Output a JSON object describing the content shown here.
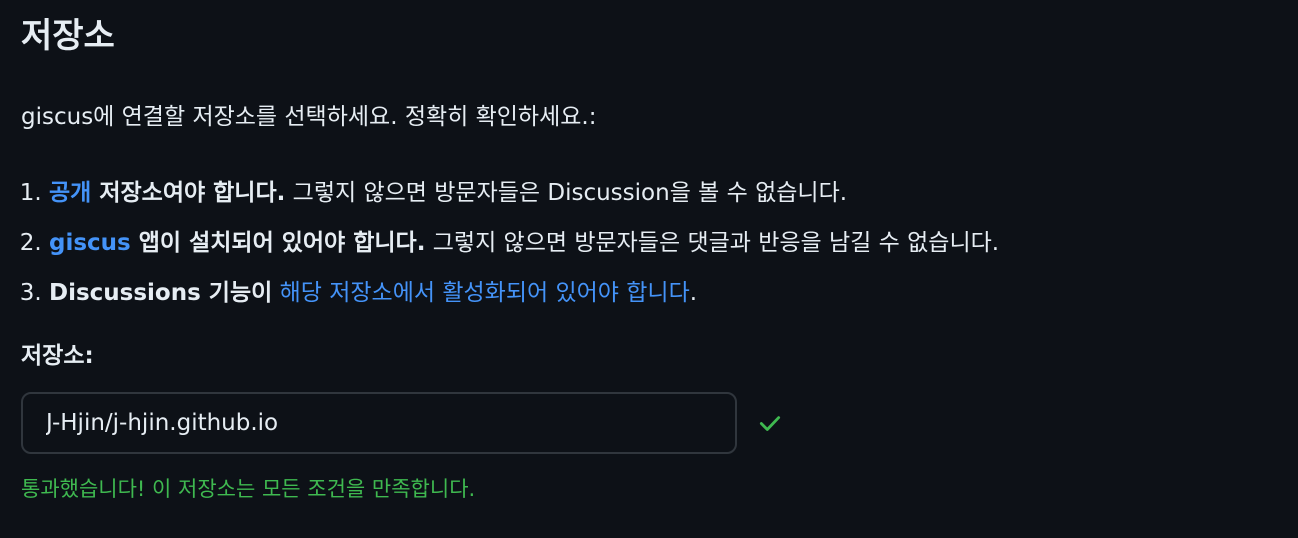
{
  "section": {
    "title": "저장소",
    "intro": "giscus에 연결할 저장소를 선택하세요. 정확히 확인하세요.:"
  },
  "requirements": [
    {
      "link": "공개",
      "bold": " 저장소여야 합니다.",
      "rest": " 그렇지 않으면 방문자들은 Discussion을 볼 수 없습니다."
    },
    {
      "link": "giscus",
      "bold": " 앱이 설치되어 있어야 합니다.",
      "rest": " 그렇지 않으면 방문자들은 댓글과 반응을 남길 수 없습니다."
    },
    {
      "bold": "Discussions 기능이",
      "space": " ",
      "link": "해당 저장소에서 활성화되어 있어야 합니다",
      "rest": "."
    }
  ],
  "repository": {
    "label": "저장소:",
    "value": "J-Hjin/j-hjin.github.io",
    "status_icon": "check-icon",
    "success_message": "통과했습니다! 이 저장소는 모든 조건을 만족합니다."
  },
  "colors": {
    "background": "#0d1117",
    "text": "#e6edf3",
    "link": "#4493f8",
    "success": "#3fb950",
    "border": "#30363d"
  }
}
